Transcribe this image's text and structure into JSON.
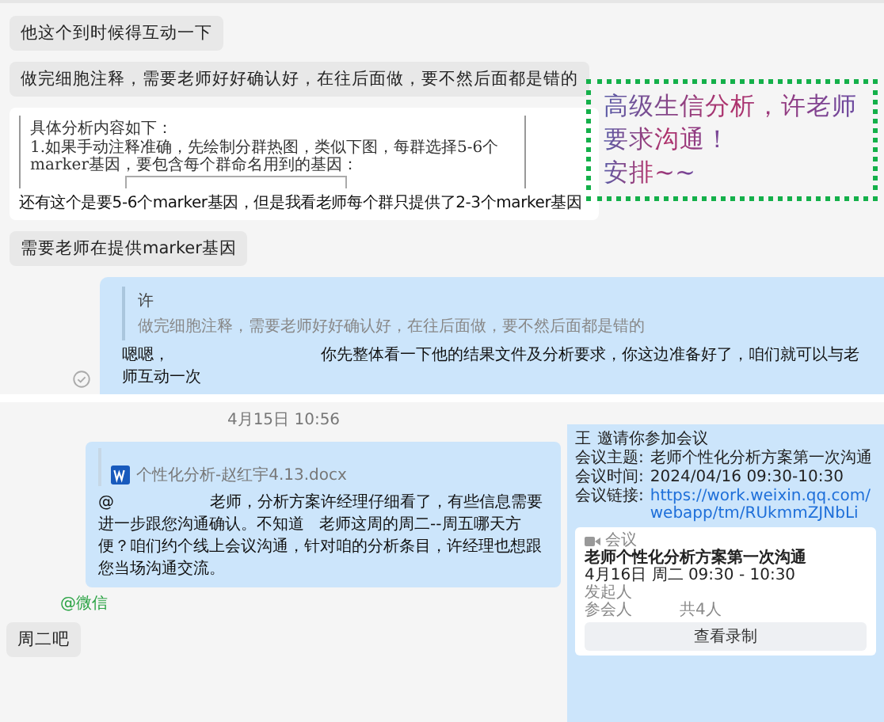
{
  "top_chat": {
    "messages": [
      {
        "kind": "bubble",
        "text": "他这个到时候得互动一下"
      },
      {
        "kind": "bubble",
        "text": "做完细胞注释，需要老师好好确认好，在往后面做，要不然后面都是错的"
      },
      {
        "kind": "document",
        "excerpt": [
          "具体分析内容如下：",
          "1.如果手动注释准确，先绘制分群热图，类似下图，每群选择5-6个marker基因，要包含每个群命名用到的基因："
        ],
        "caption": "还有这个是要5-6个marker基因，但是我看老师每个群只提供了2-3个marker基因"
      },
      {
        "kind": "bubble",
        "text": "需要老师在提供marker基因"
      },
      {
        "kind": "reply",
        "quote_author": "许",
        "quote_text": "做完细胞注释，需要老师好好确认好，在往后面做，要不然后面都是错的",
        "text": "嗯嗯，                              你先整体看一下他的结果文件及分析要求，你这边准备好了，咱们就可以与老师互动一次",
        "read": true
      }
    ]
  },
  "callout": {
    "lines": [
      "高级生信分析，许老师",
      "要求沟通！",
      "安排~~"
    ]
  },
  "bottom_chat": {
    "timestamp": "4月15日 10:56",
    "messages": [
      {
        "kind": "file-reply",
        "file_name": "个性化分析-赵红宇4.13.docx",
        "text": "@                   老师，分析方案许经理仔细看了，有些信息需要进一步跟您沟通确认。不知道   老师这周的周二--周五哪天方便？咱们约个线上会议沟通，针对咱的分析条目，许经理也想跟您当场沟通交流。"
      },
      {
        "kind": "source",
        "text": "@微信"
      },
      {
        "kind": "bubble",
        "text": "周二吧"
      }
    ]
  },
  "meeting_invite": {
    "inviter": "王",
    "invite_text": "邀请你参加会议",
    "fields": [
      {
        "label": "会议主题:",
        "value": "老师个性化分析方案第一次沟通",
        "kind": "text"
      },
      {
        "label": "会议时间:",
        "value": "2024/04/16 09:30-10:30",
        "kind": "text"
      },
      {
        "label": "会议链接:",
        "value": "https://work.weixin.qq.com/webapp/tm/RUkmmZJNbLi",
        "kind": "link"
      }
    ],
    "card": {
      "tag": "会议",
      "title": "老师个性化分析方案第一次沟通",
      "time": "4月16日 周二 09:30 - 10:30",
      "rows": [
        {
          "label": "发起人",
          "value": ""
        },
        {
          "label": "参会人",
          "value": "共4人"
        }
      ],
      "button": "查看录制"
    }
  }
}
